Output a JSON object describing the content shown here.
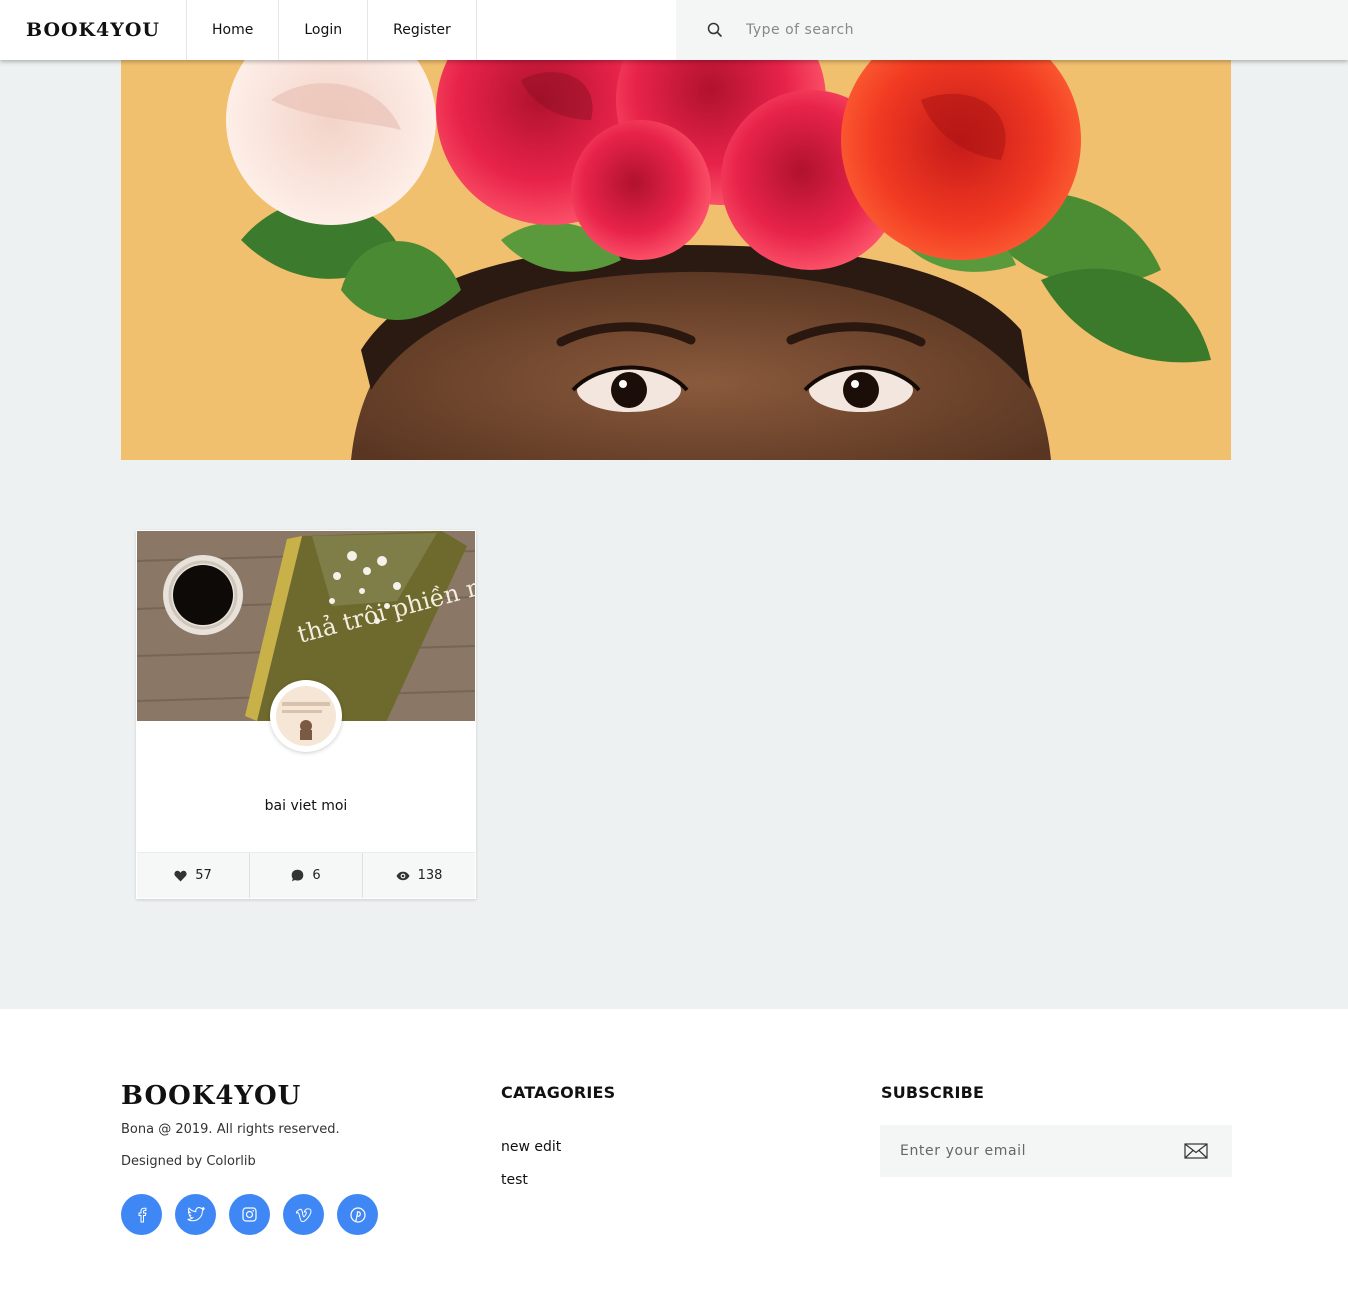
{
  "header": {
    "logo": "BOOK4YOU",
    "nav": [
      {
        "label": "Home"
      },
      {
        "label": "Login"
      },
      {
        "label": "Register"
      }
    ],
    "search": {
      "placeholder": "Type of search"
    }
  },
  "post": {
    "title": "bai viet moi",
    "cover_text": "thả trôi phiền muộn",
    "stats": {
      "likes": "57",
      "comments": "6",
      "views": "138"
    }
  },
  "footer": {
    "logo": "BOOK4YOU",
    "copyright": "Bona @ 2019. All rights reserved.",
    "designed": "Designed by Colorlib",
    "socials": [
      {
        "icon": "facebook-icon",
        "glyph": "f"
      },
      {
        "icon": "twitter-icon",
        "glyph": "t"
      },
      {
        "icon": "instagram-icon",
        "glyph": "i"
      },
      {
        "icon": "vimeo-icon",
        "glyph": "v"
      },
      {
        "icon": "pinterest-icon",
        "glyph": "p"
      }
    ],
    "categories_title": "CATAGORIES",
    "categories": [
      {
        "label": "new edit"
      },
      {
        "label": "test"
      }
    ],
    "subscribe_title": "SUBSCRIBE",
    "email_placeholder": "Enter your email"
  },
  "colors": {
    "page_bg": "#edf1f1",
    "social_blue": "#3f87f5",
    "hero_bg": "#f1c06f"
  }
}
